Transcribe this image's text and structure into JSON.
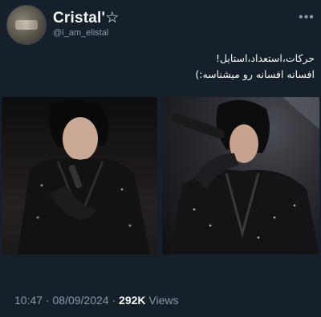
{
  "author": {
    "display_name": "Cristal'☆",
    "handle": "@i_am_elistal",
    "avatar_icon": "profile-avatar"
  },
  "more_icon": "more-horizontal-icon",
  "more_glyph": "•••",
  "tweet": {
    "line1": "حرکات،استعداد،استایل!",
    "line2": "افسانه افسانه رو میشناسه:)"
  },
  "media": {
    "count": 2,
    "left_photo": "performer-photo-left",
    "right_photo": "performer-photo-right"
  },
  "meta": {
    "time": "10:47",
    "date": "08/09/2024",
    "sep1": " · ",
    "sep2": " · ",
    "views_count": "292K",
    "views_label": " Views"
  },
  "colors": {
    "background": "#15202b",
    "primary_text": "#f7f9f9",
    "secondary_text": "#8b98a5"
  }
}
